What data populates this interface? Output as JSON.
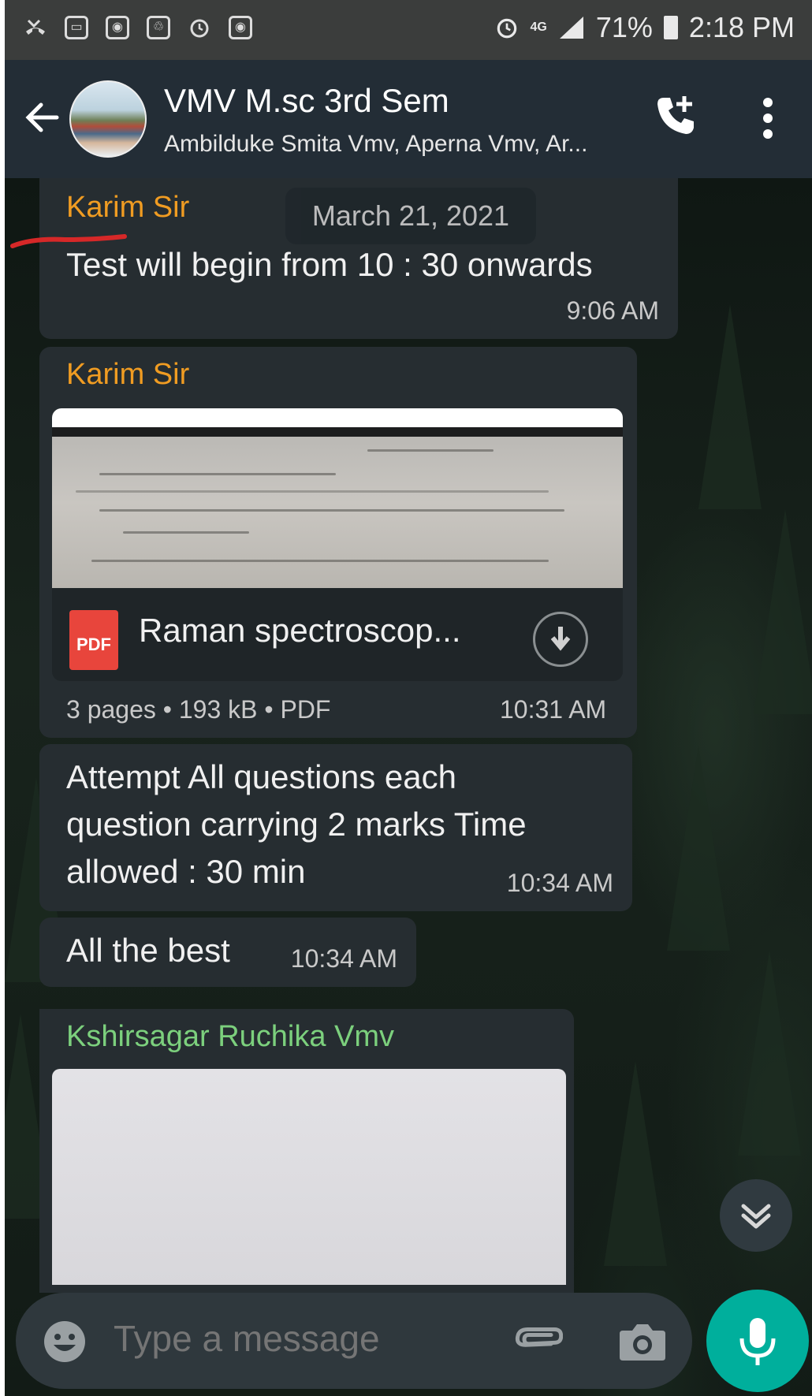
{
  "status_bar": {
    "notification_icons": [
      "missed-call-icon",
      "image-icon",
      "app-icon",
      "recycle-icon",
      "alarm-icon",
      "app-icon"
    ],
    "network": "4G",
    "battery": "71%",
    "time": "2:18 PM"
  },
  "header": {
    "title": "VMV M.sc 3rd Sem",
    "subtitle": "Ambilduke Smita Vmv, Aperna Vmv, Ar..."
  },
  "date_chip": "March 21, 2021",
  "messages": [
    {
      "sender": "Karim Sir",
      "text": "Test will begin from 10 : 30 onwards",
      "time": "9:06 AM"
    },
    {
      "sender": "Karim Sir",
      "document": {
        "name": "Raman spectroscop...",
        "icon_label": "PDF",
        "meta": "3 pages • 193 kB • PDF"
      },
      "time": "10:31 AM"
    },
    {
      "text": "Attempt All questions each question carrying 2 marks Time allowed : 30 min",
      "time": "10:34 AM"
    },
    {
      "text": "All the best",
      "time": "10:34 AM"
    },
    {
      "sender": "Kshirsagar Ruchika Vmv"
    }
  ],
  "composer": {
    "placeholder": "Type a message"
  },
  "colors": {
    "header": "#232d36",
    "bubble": "#262d31",
    "sender_karim": "#f09c22",
    "sender_kshirsagar": "#7cd07d",
    "mic_button": "#00af9c"
  }
}
